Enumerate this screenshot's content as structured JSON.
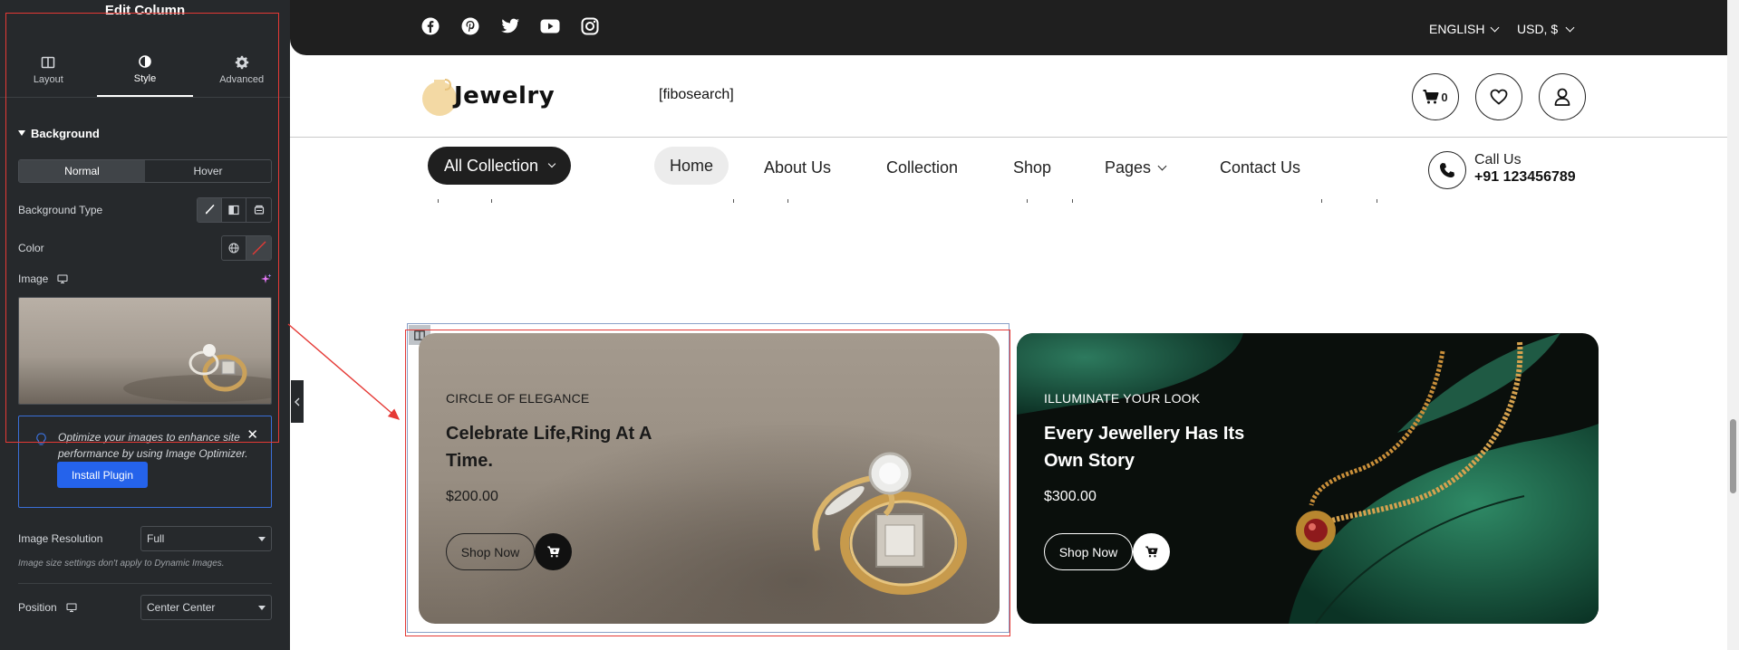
{
  "panel": {
    "title": "Edit Column",
    "tabs": [
      {
        "label": "Layout",
        "icon": "layout-icon"
      },
      {
        "label": "Style",
        "icon": "style-icon"
      },
      {
        "label": "Advanced",
        "icon": "gear-icon"
      }
    ],
    "active_tab": "Style",
    "section_title": "Background",
    "state_toggle": {
      "options": [
        "Normal",
        "Hover"
      ],
      "selected": "Normal"
    },
    "background_type": {
      "label": "Background Type",
      "options": [
        "brush-icon",
        "gradient-icon",
        "slideshow-icon"
      ],
      "selected": "brush-icon"
    },
    "color": {
      "label": "Color"
    },
    "image": {
      "label": "Image"
    },
    "notice": {
      "text": "Optimize your images to enhance site performance by using Image Optimizer.",
      "button_label": "Install Plugin"
    },
    "image_resolution": {
      "label": "Image Resolution",
      "value": "Full"
    },
    "resolution_note": "Image size settings don't apply to Dynamic Images.",
    "position": {
      "label": "Position",
      "value": "Center Center"
    }
  },
  "site": {
    "topbar": {
      "socials": [
        "facebook-icon",
        "pinterest-icon",
        "twitter-icon",
        "youtube-icon",
        "instagram-icon"
      ],
      "language": "ENGLISH",
      "currency": "USD, $"
    },
    "header": {
      "logo_text": "Jewelry",
      "search_placeholder": "[fibosearch]",
      "cart_count": "0"
    },
    "nav": {
      "all_collection": "All Collection",
      "links": [
        "Home",
        "About Us",
        "Collection",
        "Shop",
        "Pages",
        "Contact Us"
      ],
      "active": "Home",
      "call_label": "Call Us",
      "call_number": "+91 123456789"
    },
    "banners": [
      {
        "kicker": "CIRCLE OF ELEGANCE",
        "title": "Celebrate Life,Ring At A Time.",
        "price": "$200.00",
        "button": "Shop Now"
      },
      {
        "kicker": "ILLUMINATE YOUR LOOK",
        "title": "Every Jewellery Has Its Own Story",
        "price": "$300.00",
        "button": "Shop Now"
      }
    ]
  },
  "colors": {
    "panel_bg": "#26292c",
    "topbar_bg": "#1f1f1f",
    "accent_blue": "#2563eb",
    "highlight_red": "#e53935"
  }
}
